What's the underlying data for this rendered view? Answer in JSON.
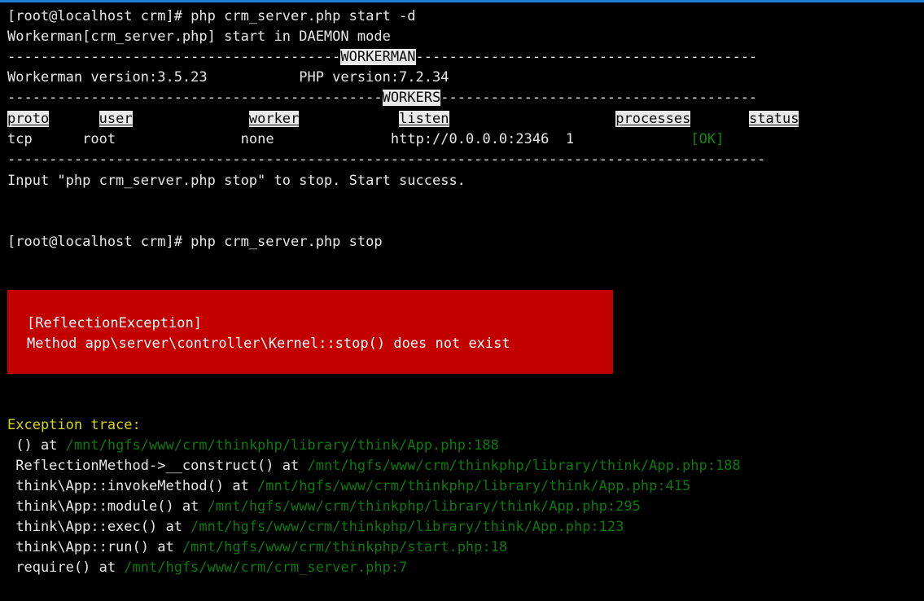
{
  "terminal": {
    "prompt_start": "[root@localhost crm]# php crm_server.php start -d",
    "daemon_line": "Workerman[crm_server.php] start in DAEMON mode",
    "banner": {
      "workerman_label": "WORKERMAN",
      "workers_label": "WORKERS",
      "rule_left_workerman": "----------------------------------------",
      "rule_right_workerman": "-----------------------------------------",
      "rule_left_workers": "---------------------------------------------",
      "rule_right_workers": "--------------------------------------",
      "rule_full": "-------------------------------------------------------------------------------------------"
    },
    "versions": {
      "workerman": "Workerman version:3.5.23",
      "php": "PHP version:7.2.34"
    },
    "table": {
      "headers": [
        "proto",
        "user",
        "worker",
        "listen",
        "processes",
        "status"
      ],
      "row": [
        "tcp",
        "root",
        "none",
        "http://0.0.0.0:2346",
        "1",
        "[OK]"
      ],
      "status_color": "#0a8a0a"
    },
    "start_success": "Input \"php crm_server.php stop\" to stop. Start success.",
    "prompt_stop": "[root@localhost crm]# php crm_server.php stop"
  },
  "error_box": {
    "background": "#c20000",
    "exception_name": "[ReflectionException]",
    "message": "Method app\\server\\controller\\Kernel::stop() does not exist"
  },
  "trace": {
    "heading": "Exception trace:",
    "heading_color": "#d7d700",
    "path_color": "#0b7a0b",
    "entries": [
      {
        "call": " () at ",
        "path": "/mnt/hgfs/www/crm/thinkphp/library/think/App.php:188"
      },
      {
        "call": " ReflectionMethod->__construct() at ",
        "path": "/mnt/hgfs/www/crm/thinkphp/library/think/App.php:188"
      },
      {
        "call": " think\\App::invokeMethod() at ",
        "path": "/mnt/hgfs/www/crm/thinkphp/library/think/App.php:415"
      },
      {
        "call": " think\\App::module() at ",
        "path": "/mnt/hgfs/www/crm/thinkphp/library/think/App.php:295"
      },
      {
        "call": " think\\App::exec() at ",
        "path": "/mnt/hgfs/www/crm/thinkphp/library/think/App.php:123"
      },
      {
        "call": " think\\App::run() at ",
        "path": "/mnt/hgfs/www/crm/thinkphp/start.php:18"
      },
      {
        "call": " require() at ",
        "path": "/mnt/hgfs/www/crm/crm_server.php:7"
      }
    ]
  },
  "chrome": {
    "top_accent_color": "#1a7fd4",
    "gutter_color": "#c9c9c9"
  }
}
